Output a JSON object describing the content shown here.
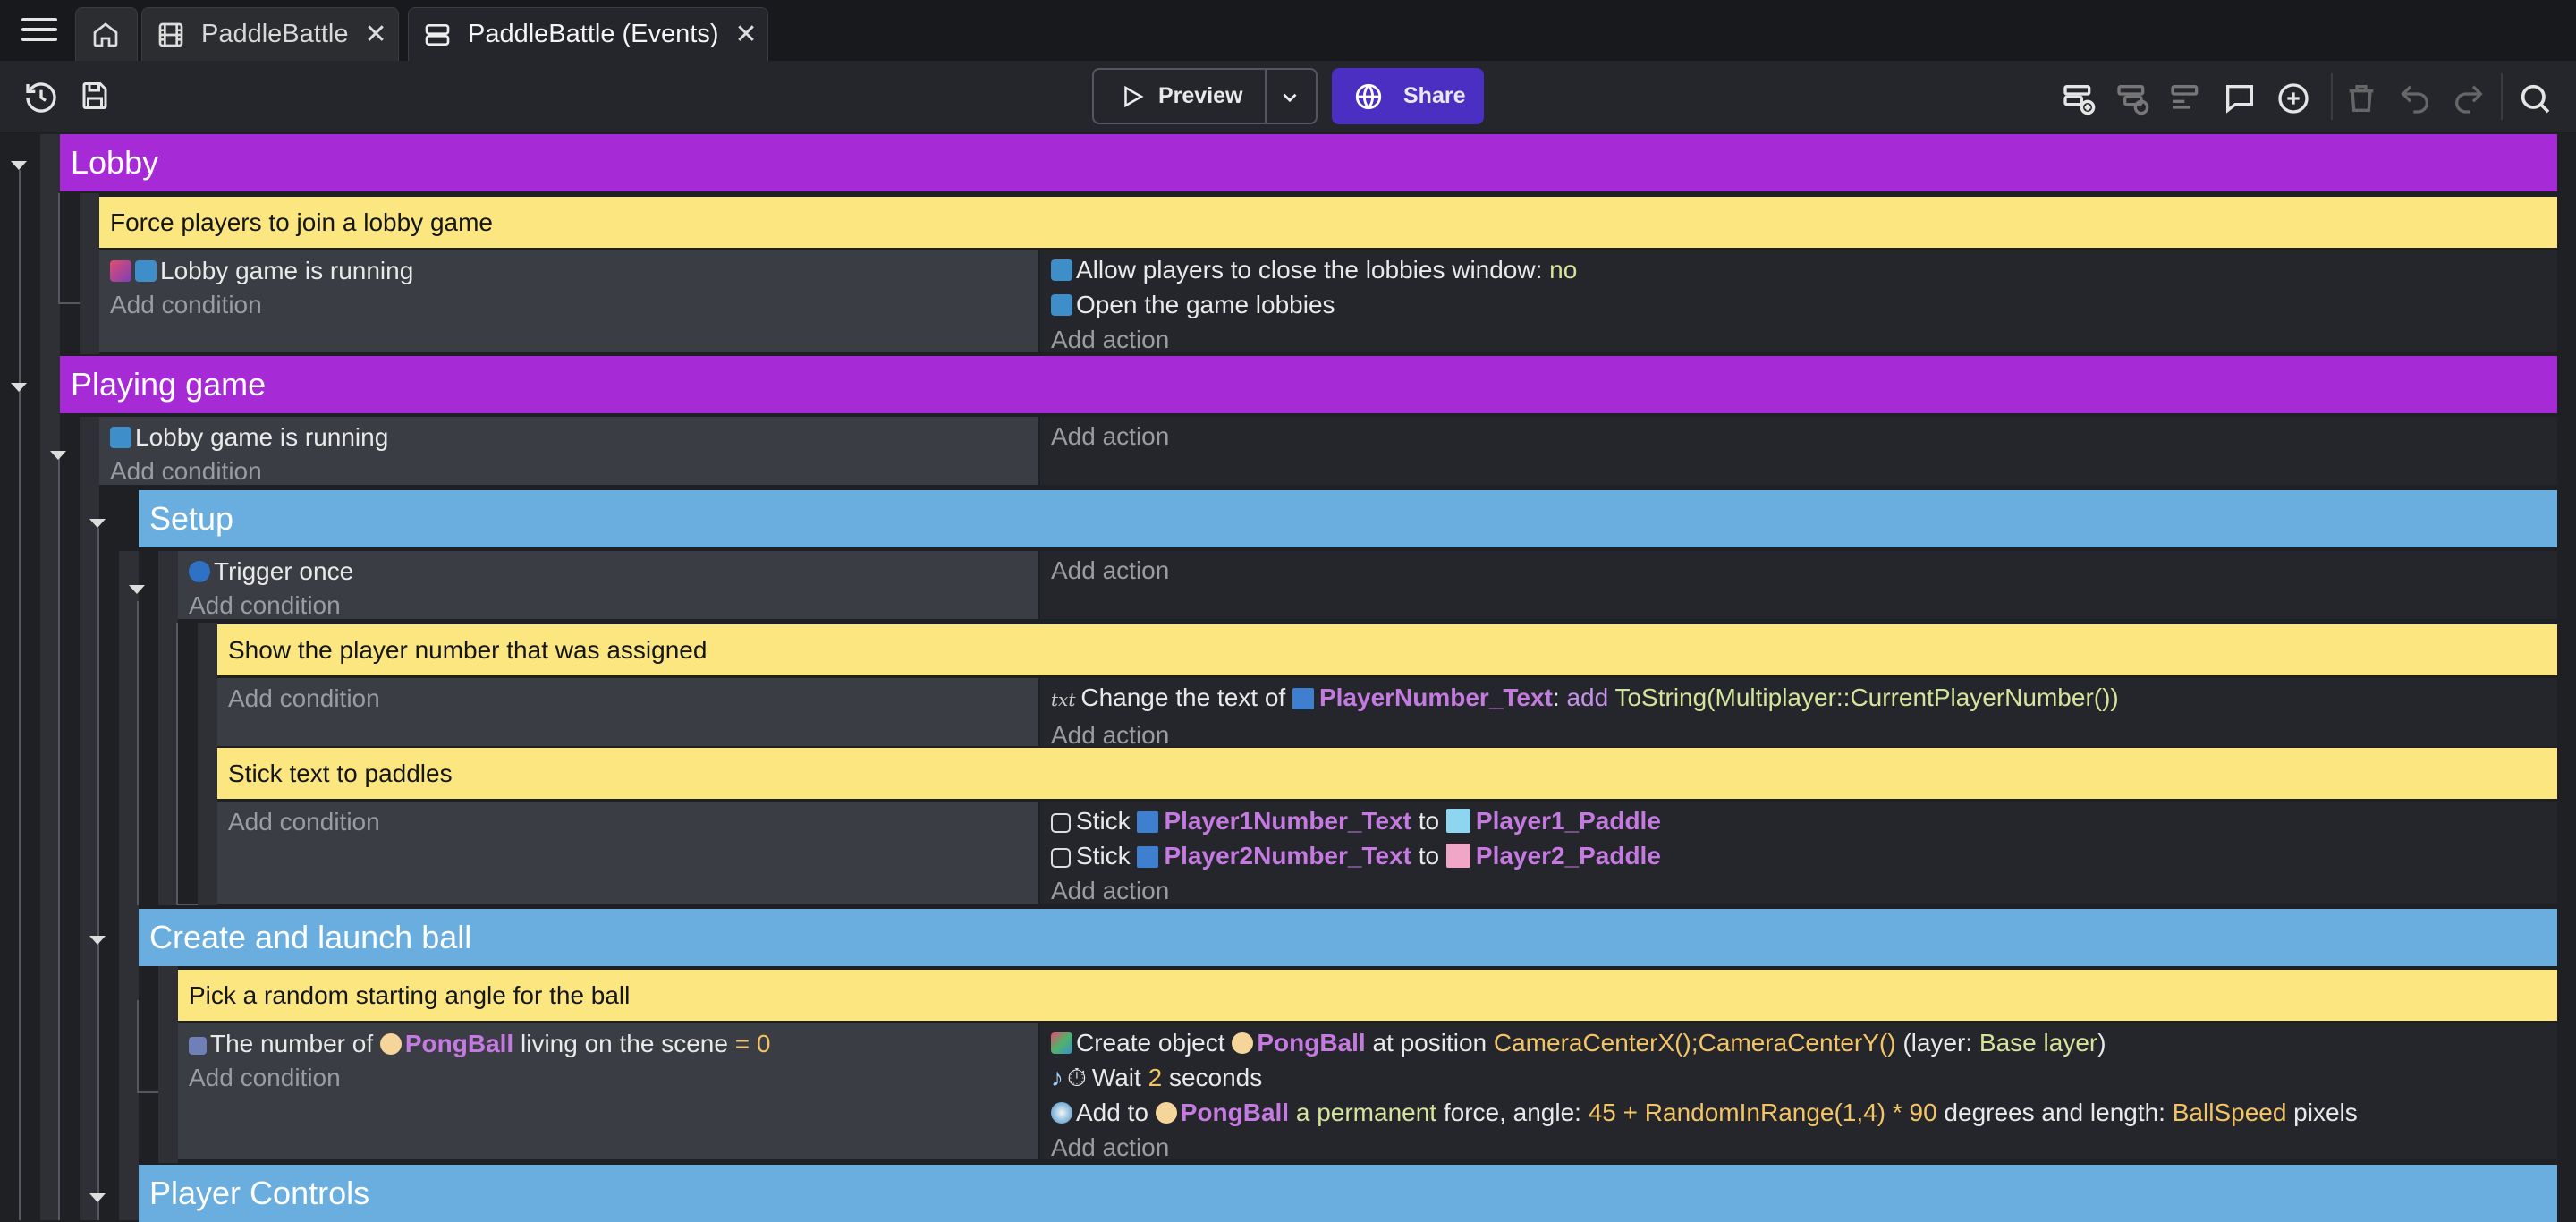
{
  "tabs": [
    {
      "label": "PaddleBattle"
    },
    {
      "label": "PaddleBattle (Events)"
    }
  ],
  "toolbar": {
    "preview": "Preview",
    "share": "Share"
  },
  "events": {
    "lobby": {
      "title": "Lobby",
      "comment": "Force players to join a lobby game",
      "cond": "Lobby game is running",
      "add_condition": "Add condition",
      "act1_a": "Allow players to close the lobbies window: ",
      "act1_b": "no",
      "act2": "Open the game lobbies",
      "add_action": "Add action"
    },
    "playing": {
      "title": "Playing game",
      "cond": "Lobby game is running",
      "add_condition": "Add condition",
      "add_action": "Add action"
    },
    "setup": {
      "title": "Setup",
      "cond": "Trigger once",
      "add_condition": "Add condition",
      "add_action": "Add action",
      "comment1": "Show the player number that was assigned",
      "sub1_add_condition": "Add condition",
      "sub1_act_a": "Change the text of ",
      "sub1_obj": "PlayerNumber_Text",
      "sub1_act_b": ": ",
      "sub1_op": "add",
      "sub1_expr": "ToString(Multiplayer::CurrentPlayerNumber())",
      "sub1_add_action": "Add action",
      "comment2": "Stick text to paddles",
      "sub2_add_condition": "Add condition",
      "stick": "Stick ",
      "to": "to",
      "obj_p1t": "Player1Number_Text",
      "obj_p1p": "Player1_Paddle",
      "obj_p2t": "Player2Number_Text",
      "obj_p2p": "Player2_Paddle",
      "sub2_add_action": "Add action"
    },
    "launch": {
      "title": "Create and launch ball",
      "comment": "Pick a random starting angle for the ball",
      "cond_a": "The number of ",
      "cond_obj": "PongBall",
      "cond_b": " living on the scene ",
      "cond_eq": "=",
      "cond_val": "0",
      "add_condition": "Add condition",
      "a1_a": "Create object ",
      "a1_obj": "PongBall",
      "a1_b": " at position ",
      "a1_x": "CameraCenterX()",
      "a1_sep": ";",
      "a1_y": "CameraCenterY()",
      "a1_c": " (layer: ",
      "a1_layer": "Base layer",
      "a1_d": ")",
      "a2_a": "Wait ",
      "a2_val": "2",
      "a2_b": " seconds",
      "a3_a": "Add to ",
      "a3_obj": "PongBall",
      "a3_kind": "a permanent",
      "a3_b": " force, angle: ",
      "a3_expr": "45 + RandomInRange(1,4) * 90",
      "a3_c": " degrees and length: ",
      "a3_len": "BallSpeed",
      "a3_d": " pixels",
      "add_action": "Add action"
    },
    "controls": {
      "title": "Player Controls"
    }
  }
}
